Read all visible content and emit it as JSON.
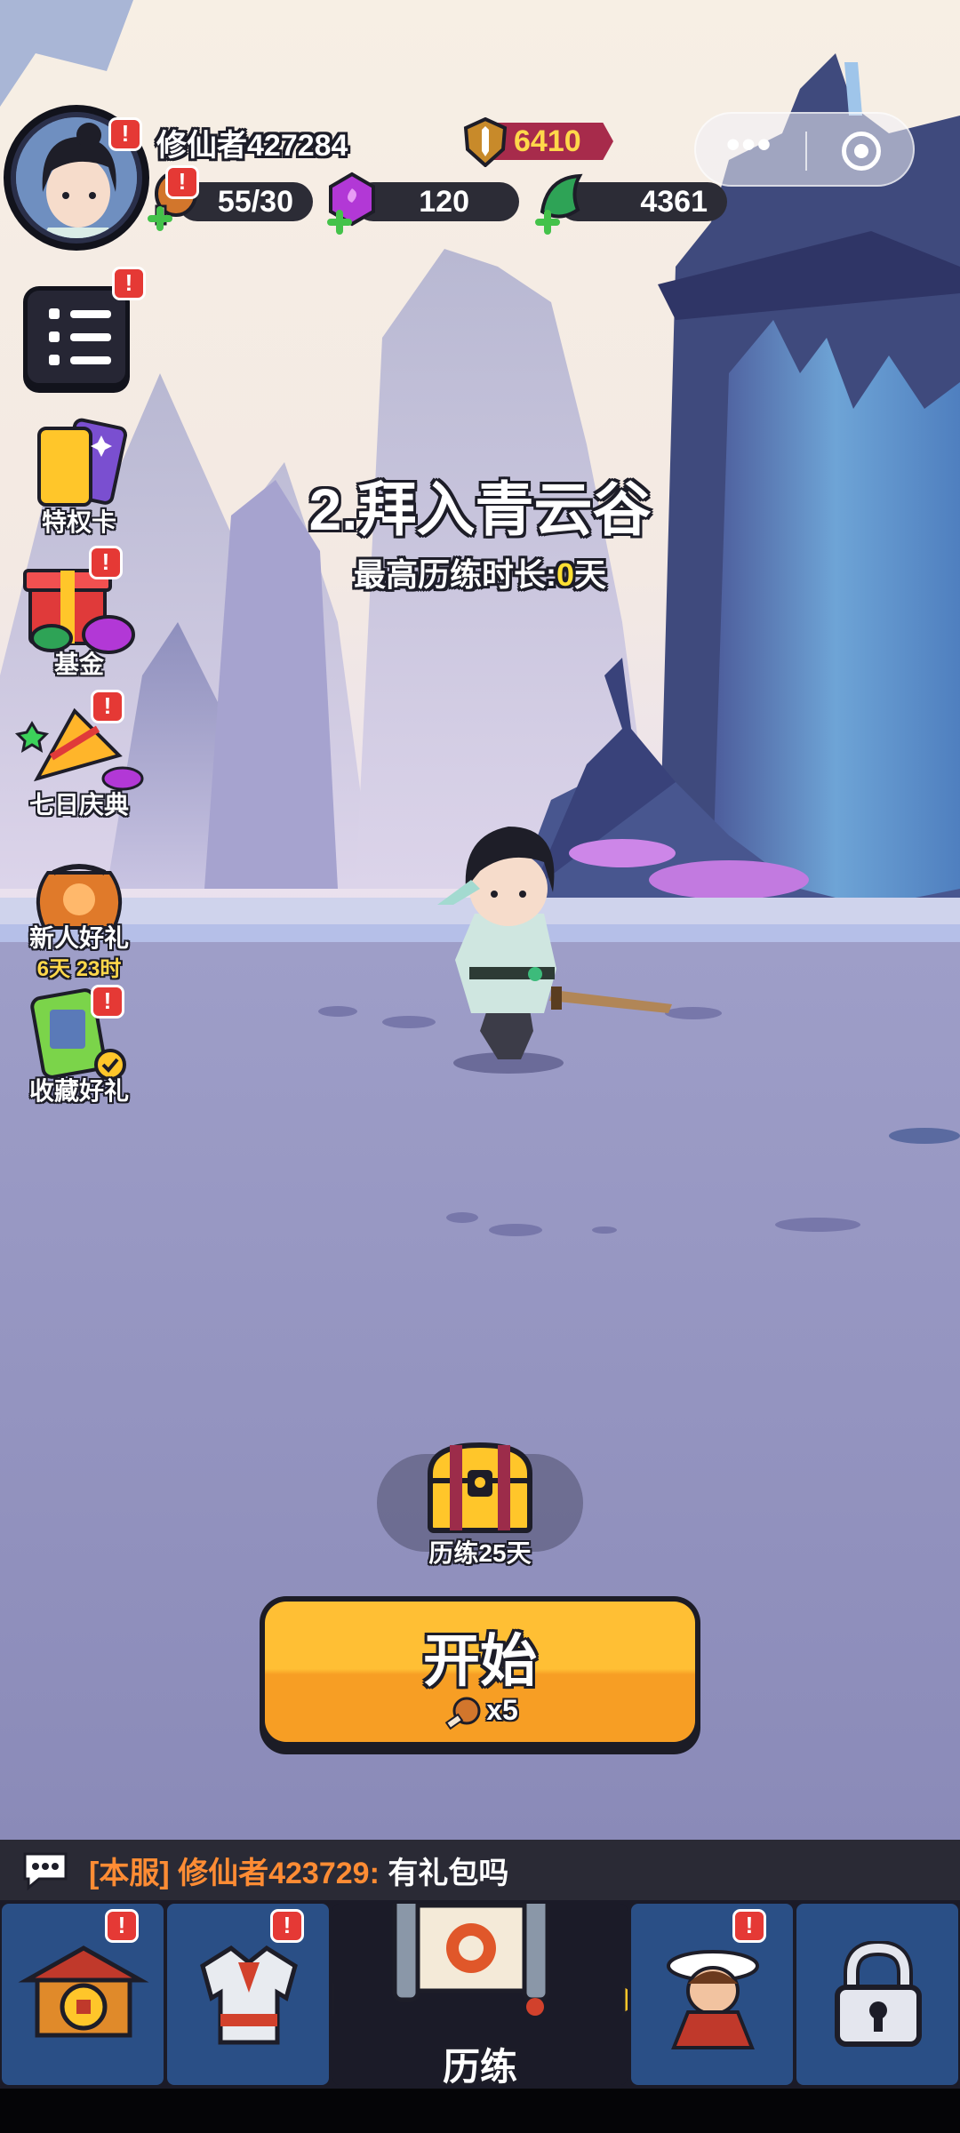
{
  "player": {
    "name": "修仙者427284",
    "power": "6410"
  },
  "resources": {
    "stamina": "55/30",
    "gems": "120",
    "jade": "4361"
  },
  "side_menu": {
    "items": [
      {
        "label": "特权卡"
      },
      {
        "label": "基金"
      },
      {
        "label": "七日庆典"
      },
      {
        "label": "新人好礼",
        "sub": "6天 23时"
      },
      {
        "label": "收藏好礼"
      }
    ]
  },
  "stage": {
    "title": "2.拜入青云谷",
    "sub_prefix": "最高历练时长:",
    "sub_value": "0",
    "sub_suffix": "天"
  },
  "chest": {
    "label": "历练25天"
  },
  "start_button": {
    "label": "开始",
    "cost": "x5"
  },
  "chat": {
    "server": "[本服]",
    "user": "修仙者423729:",
    "message": "有礼包吗"
  },
  "tabs": {
    "active_label": "历练",
    "icons": [
      "hall-icon",
      "armor-icon",
      "scroll-icon",
      "monk-icon",
      "lock-icon"
    ]
  },
  "colors": {
    "accent_orange": "#ffbf34",
    "badge_red": "#e53935",
    "tab_blue": "#2a4f86",
    "power_red": "#a72b4b"
  }
}
